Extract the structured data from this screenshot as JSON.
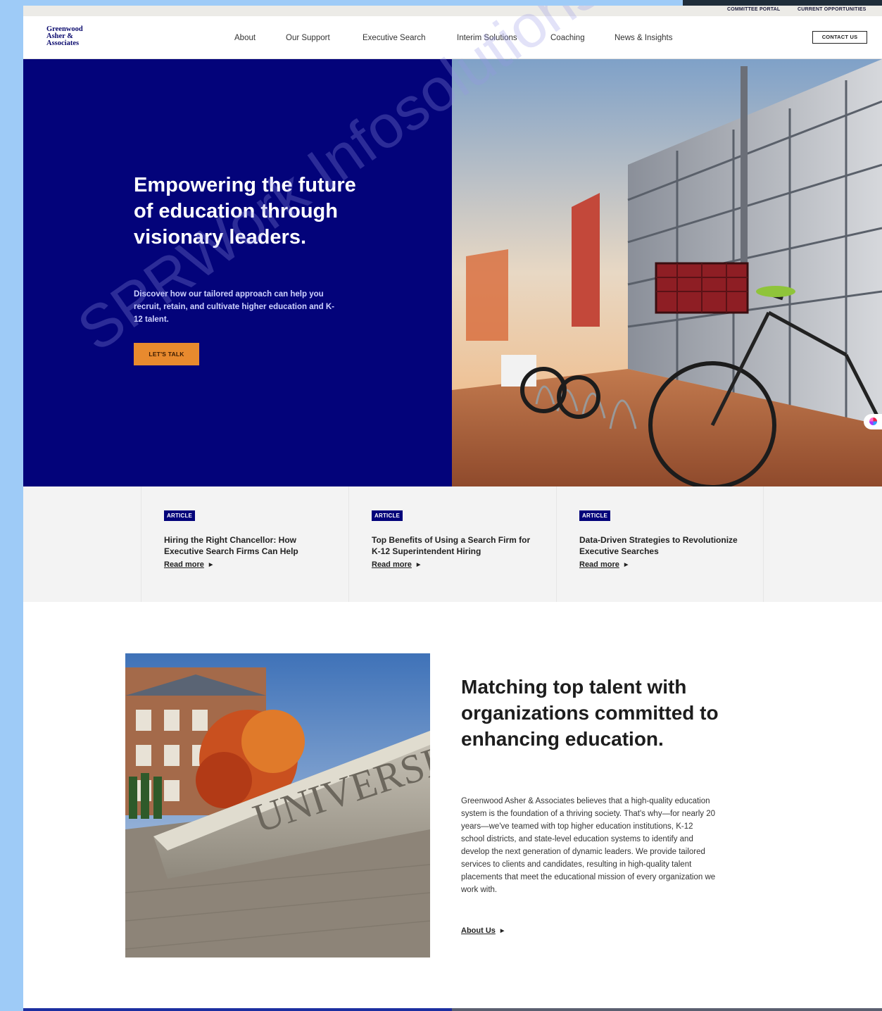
{
  "utility_bar": {
    "links": [
      "COMMITTEE PORTAL",
      "CURRENT OPPORTUNITIES"
    ]
  },
  "header": {
    "logo_lines": [
      "Greenwood",
      "Asher &",
      "Associates"
    ],
    "nav": [
      "About",
      "Our Support",
      "Executive Search",
      "Interim Solutions",
      "Coaching",
      "News & Insights"
    ],
    "contact_label": "CONTACT US"
  },
  "hero": {
    "title": "Empowering the future of education through visionary leaders.",
    "subtitle": "Discover how our tailored approach can help you recruit, retain, and cultivate higher education and K-12 talent.",
    "cta_label": "LET'S TALK",
    "image_icon": "bicycles-campus-photo"
  },
  "articles": [
    {
      "badge": "ARTICLE",
      "title": "Hiring the Right Chancellor: How Executive Search Firms Can Help",
      "link": "Read more"
    },
    {
      "badge": "ARTICLE",
      "title": "Top Benefits of Using a Search Firm for K-12 Superintendent Hiring",
      "link": "Read more"
    },
    {
      "badge": "ARTICLE",
      "title": "Data-Driven Strategies to Revolutionize Executive Searches",
      "link": "Read more"
    }
  ],
  "about": {
    "title": "Matching top talent with organizations committed to enhancing education.",
    "body": "Greenwood Asher & Associates believes that a high-quality education system is the foundation of a thriving society. That's why—for nearly 20 years—we've teamed with top higher education institutions, K-12 school districts, and state-level education systems to identify and develop the next generation of dynamic leaders. We provide tailored services to clients and candidates, resulting in high-quality talent placements that meet the educational mission of every organization we work with.",
    "link": "About Us",
    "image_icon": "university-sign-photo"
  },
  "watermark": "SPRWork Infosolutions",
  "colors": {
    "brand_navy": "#03037a",
    "cta_orange": "#e88a2e",
    "page_bg": "#9ecbf7"
  }
}
